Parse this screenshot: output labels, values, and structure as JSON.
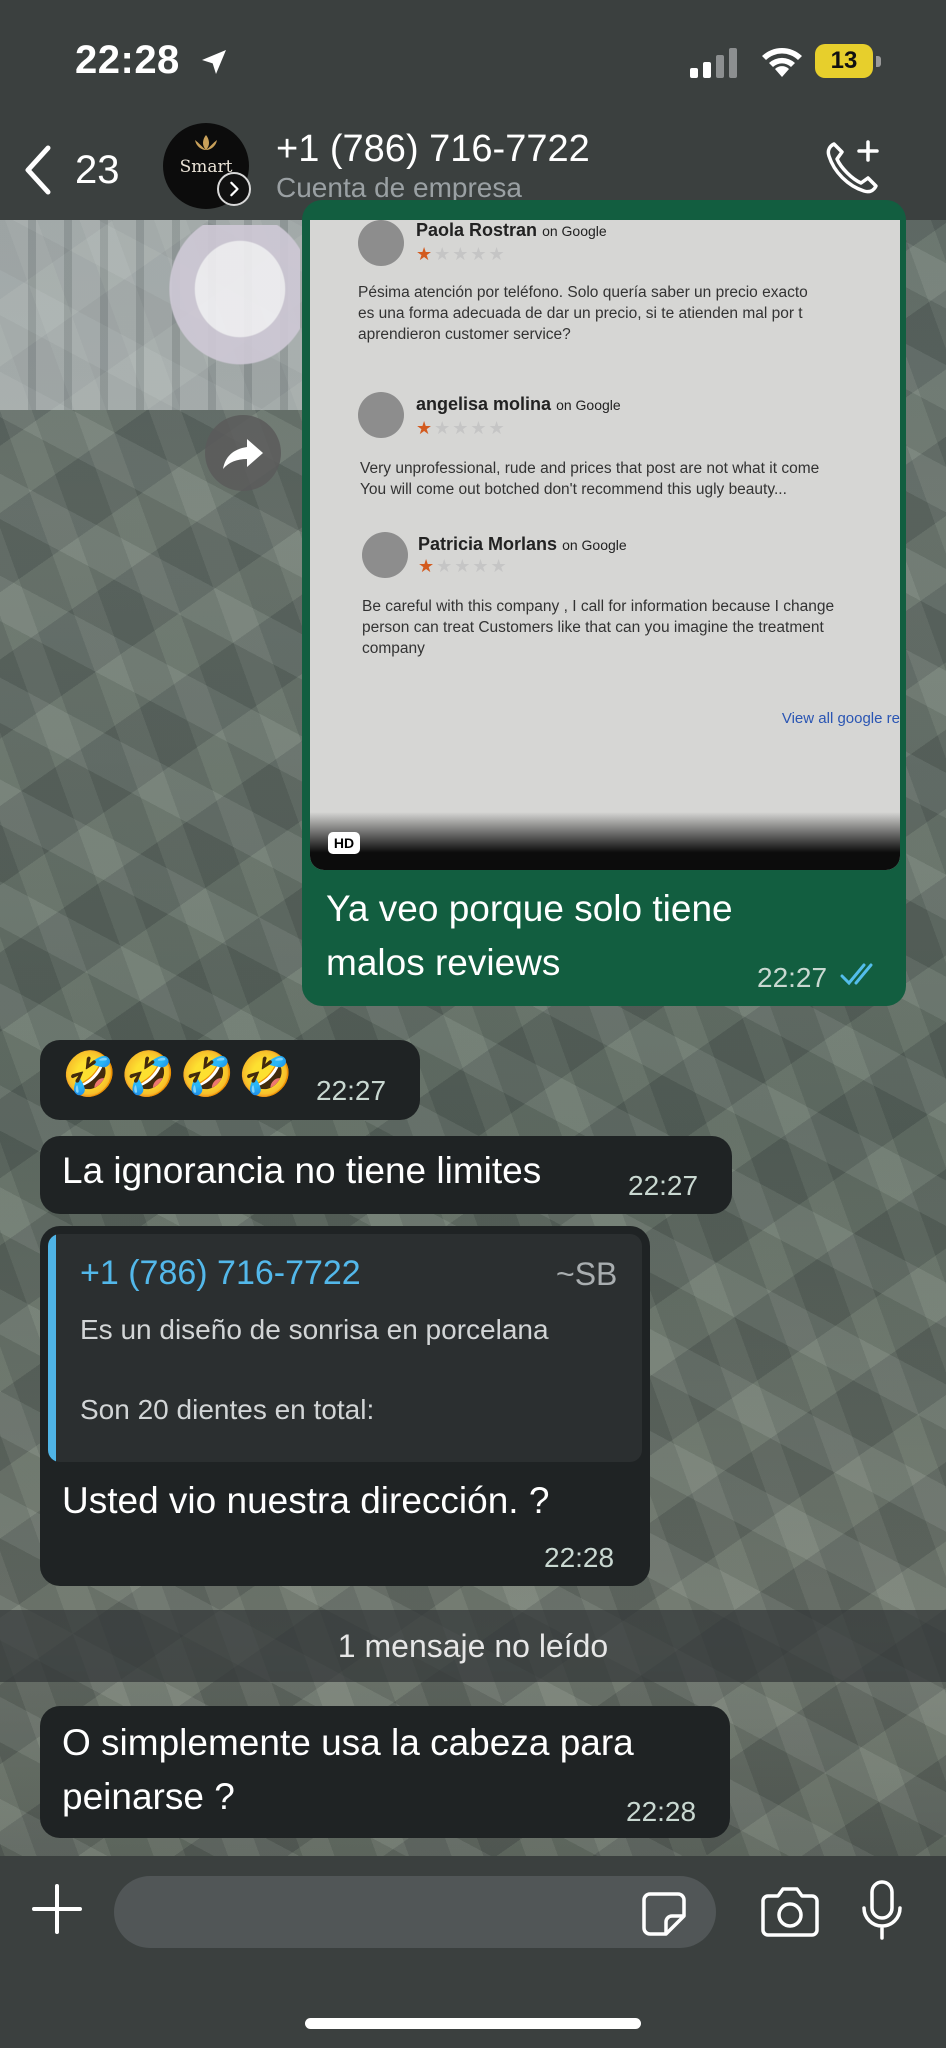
{
  "status_bar": {
    "time": "22:28",
    "battery": "13"
  },
  "header": {
    "back_count": "23",
    "avatar_brand": "Smart",
    "contact_name": "+1 (786) 716-7722",
    "contact_subtitle": "Cuenta de empresa"
  },
  "photo": {
    "reviews": [
      {
        "name": "Paola Rostran",
        "source": "on Google",
        "rating": 1,
        "stars": "★★★★★",
        "text": [
          "Pésima atención por teléfono. Solo quería saber un precio exacto",
          "es una forma adecuada de dar un precio, si te atienden mal por t",
          "aprendieron customer service?"
        ]
      },
      {
        "name": "angelisa molina",
        "source": "on Google",
        "rating": 1,
        "stars": "★★★★★",
        "text": [
          "Very unprofessional, rude and prices that post are not what it come",
          "You will come out botched don't recommend this ugly beauty..."
        ]
      },
      {
        "name": "Patricia Morlans",
        "source": "on Google",
        "rating": 1,
        "stars": "★★★★★",
        "text": [
          "Be careful with this company , I call for information because I change",
          "person can treat Customers like that can you imagine the treatment",
          "company"
        ]
      }
    ],
    "view_all": "View all google re",
    "hd_badge": "HD"
  },
  "messages": {
    "m1": {
      "text": [
        "Ya veo porque solo tiene",
        "malos reviews"
      ],
      "time": "22:27"
    },
    "m2": {
      "emoji": "🤣🤣🤣🤣",
      "time": "22:27"
    },
    "m3": {
      "text": "La ignorancia no tiene limites",
      "time": "22:27"
    },
    "m4": {
      "quote_name": "+1 (786) 716-7722",
      "quote_alias": "~SB",
      "quote_lines": [
        "Es un diseño de sonrisa en porcelana",
        "",
        "Son 20 dientes en total:"
      ],
      "text": "Usted vio nuestra dirección.  ?",
      "time": "22:28"
    },
    "m5": {
      "text": [
        "O simplemente usa la cabeza para",
        "peinarse ?"
      ],
      "time": "22:28"
    }
  },
  "unread_divider": "1 mensaje no leído",
  "colors": {
    "outgoing_bubble": "#125e40",
    "incoming_bubble": "#1f2324",
    "quote_accent": "#4fb4e6",
    "read_ticks": "#53bdeb",
    "battery": "#e7cf2c"
  },
  "icons": [
    "location-arrow-icon",
    "signal-icon",
    "wifi-icon",
    "battery-icon",
    "back-chevron-icon",
    "business-badge-icon",
    "add-call-icon",
    "forward-icon",
    "plus-icon",
    "sticker-icon",
    "camera-icon",
    "microphone-icon"
  ]
}
